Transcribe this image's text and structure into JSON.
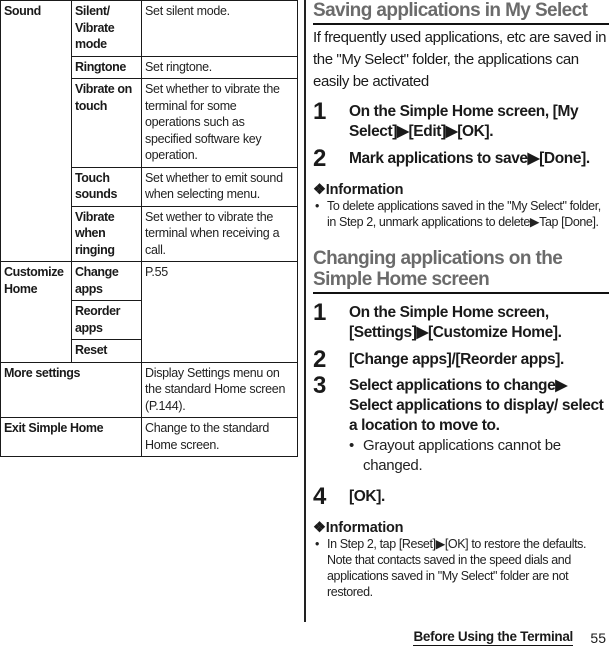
{
  "table": {
    "sound": {
      "group": "Sound",
      "rows": [
        {
          "item": "Silent/ Vibrate mode",
          "desc": "Set silent mode."
        },
        {
          "item": "Ringtone",
          "desc": "Set ringtone."
        },
        {
          "item": "Vibrate on touch",
          "desc": "Set whether to vibrate the terminal for some operations such as specified software key operation."
        },
        {
          "item": "Touch sounds",
          "desc": "Set whether to emit sound when selecting menu."
        },
        {
          "item": "Vibrate when ringing",
          "desc": "Set wether to vibrate the terminal when receiving a call."
        }
      ]
    },
    "customize": {
      "group": "Customize Home",
      "rows": [
        {
          "item": "Change apps"
        },
        {
          "item": "Reorder apps"
        },
        {
          "item": "Reset"
        }
      ],
      "desc": "P.55"
    },
    "more_settings": {
      "item": "More settings",
      "desc": "Display Settings menu on the standard Home screen (P.144)."
    },
    "exit": {
      "item": "Exit Simple Home",
      "desc": "Change to the standard Home screen."
    }
  },
  "section1": {
    "title": "Saving applications in My Select",
    "intro": "If frequently used applications, etc are saved in the \"My Select\" folder, the applications can easily be activated",
    "steps": [
      {
        "num": "1",
        "text": "On the Simple Home screen, [My Select]▶[Edit]▶[OK]."
      },
      {
        "num": "2",
        "text": "Mark applications to save▶[Done]."
      }
    ],
    "info_title": "❖Information",
    "info_items": [
      "To delete applications saved in the \"My Select\" folder, in Step 2, unmark applications to delete▶Tap [Done]."
    ]
  },
  "section2": {
    "title": "Changing applications on the Simple Home screen",
    "steps": [
      {
        "num": "1",
        "text": "On the Simple Home screen, [Settings]▶[Customize Home]."
      },
      {
        "num": "2",
        "text": "[Change apps]/[Reorder apps]."
      },
      {
        "num": "3",
        "text": "Select applications to change▶ Select applications to display/ select a location to move to.",
        "note": "Grayout applications cannot be changed."
      },
      {
        "num": "4",
        "text": "[OK]."
      }
    ],
    "info_title": "❖Information",
    "info_items": [
      "In Step 2, tap [Reset]▶[OK] to restore the defaults. Note that contacts saved in the speed dials and applications saved in \"My Select\" folder are not restored."
    ]
  },
  "footer": {
    "title": "Before Using the Terminal",
    "page": "55",
    "bullet": "•"
  }
}
